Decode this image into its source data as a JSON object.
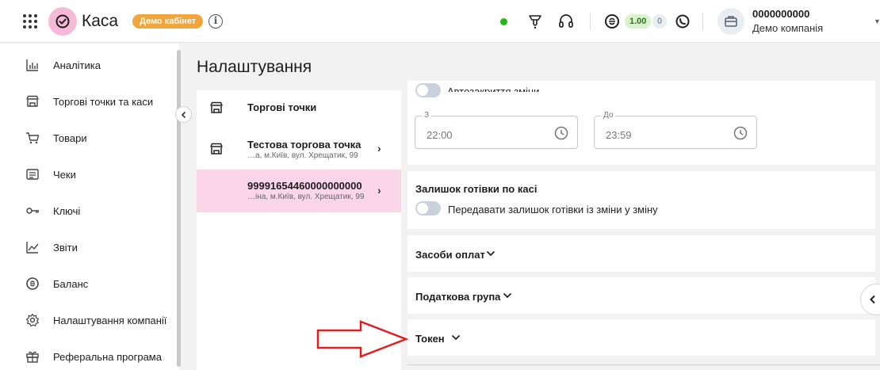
{
  "header": {
    "logo_text": "Каса",
    "demo_badge": "Демо кабінет",
    "info": "i",
    "balance_green": "1.00",
    "balance_grey": "0",
    "company_id": "0000000000",
    "company_name": "Демо компанія",
    "icons": [
      "apps-grid-icon",
      "status-dot",
      "notifications-icon",
      "headset-icon",
      "currency-icon",
      "whatsapp-icon",
      "briefcase-icon"
    ]
  },
  "sidebar": {
    "items": [
      {
        "label": "Аналітика",
        "icon": "analytics-icon"
      },
      {
        "label": "Торгові точки та каси",
        "icon": "store-icon"
      },
      {
        "label": "Товари",
        "icon": "cart-icon"
      },
      {
        "label": "Чеки",
        "icon": "receipt-icon"
      },
      {
        "label": "Ключі",
        "icon": "key-icon"
      },
      {
        "label": "Звіти",
        "icon": "chart-line-icon"
      },
      {
        "label": "Баланс",
        "icon": "balance-icon"
      },
      {
        "label": "Налаштування компанії",
        "icon": "settings-icon"
      },
      {
        "label": "Реферальна програма",
        "icon": "gift-icon"
      }
    ]
  },
  "page": {
    "title": "Налаштування"
  },
  "trade_points": {
    "header": "Торгові точки",
    "rows": [
      {
        "title": "Тестова торгова точка",
        "subtitle": "…а, м.Київ, вул. Хрещатик, 99"
      },
      {
        "title": "99991654460000000000",
        "subtitle": "…іна, м.Київ, вул. Хрещатик, 99"
      }
    ]
  },
  "shift": {
    "autoclose_label": "Автозакриття зміни",
    "from_label": "З",
    "from_value": "22:00",
    "to_label": "До",
    "to_value": "23:59"
  },
  "cash_balance": {
    "title": "Залишок готівки по касі",
    "toggle_label": "Передавати залишок готівки із зміни у зміну"
  },
  "sections": {
    "payment_methods": "Засоби оплат",
    "tax_group": "Податкова група",
    "token": "Токен"
  },
  "colors": {
    "accent_pink": "#f7b9d8",
    "active_row": "#fad6e8",
    "demo_badge": "#f2a53b",
    "status_green": "#22b814",
    "annotation_arrow": "#e02020"
  }
}
